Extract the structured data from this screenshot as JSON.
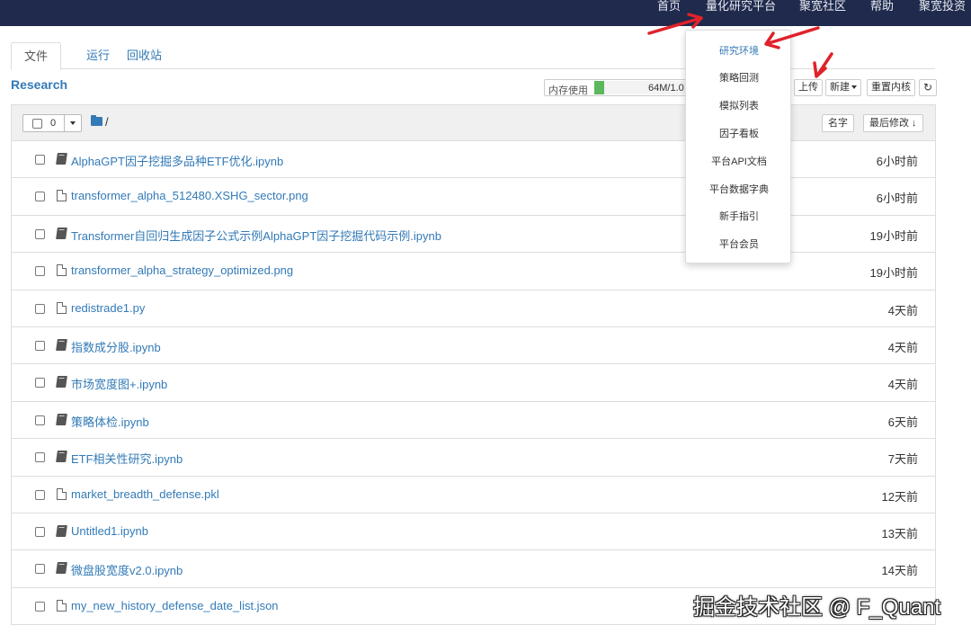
{
  "topnav": {
    "items": [
      "首页",
      "量化研究平台",
      "聚宽社区",
      "帮助",
      "聚宽投资"
    ]
  },
  "tabs": [
    "文件",
    "运行",
    "回收站"
  ],
  "research_title": "Research",
  "memory": {
    "label": "内存使用",
    "value": "64M/1.0",
    "fraction": 0.06
  },
  "toolbar": {
    "upload": "上传",
    "new": "新建",
    "restart": "重置内核",
    "reload_icon": "↻"
  },
  "listhead": {
    "selected_count": "0",
    "path": "/",
    "sort_name": "名字",
    "sort_modified": "最后修改 ↓"
  },
  "files": [
    {
      "name": "AlphaGPT因子挖掘多品种ETF优化.ipynb",
      "type": "notebook",
      "time": "6小时前"
    },
    {
      "name": "transformer_alpha_512480.XSHG_sector.png",
      "type": "file",
      "time": "6小时前"
    },
    {
      "name": "Transformer自回归生成因子公式示例AlphaGPT因子挖掘代码示例.ipynb",
      "type": "notebook",
      "time": "19小时前"
    },
    {
      "name": "transformer_alpha_strategy_optimized.png",
      "type": "file",
      "time": "19小时前"
    },
    {
      "name": "redistrade1.py",
      "type": "file",
      "time": "4天前"
    },
    {
      "name": "指数成分股.ipynb",
      "type": "notebook",
      "time": "4天前"
    },
    {
      "name": "市场宽度图+.ipynb",
      "type": "notebook",
      "time": "4天前"
    },
    {
      "name": "策略体检.ipynb",
      "type": "notebook",
      "time": "6天前"
    },
    {
      "name": "ETF相关性研究.ipynb",
      "type": "notebook",
      "time": "7天前"
    },
    {
      "name": "market_breadth_defense.pkl",
      "type": "file",
      "time": "12天前"
    },
    {
      "name": "Untitled1.ipynb",
      "type": "notebook",
      "time": "13天前"
    },
    {
      "name": "微盘股宽度v2.0.ipynb",
      "type": "notebook",
      "time": "14天前"
    },
    {
      "name": "my_new_history_defense_date_list.json",
      "type": "file",
      "time": ""
    }
  ],
  "dropdown_menu": {
    "items": [
      "研究环境",
      "策略回测",
      "模拟列表",
      "因子看板",
      "平台API文档",
      "平台数据字典",
      "新手指引",
      "平台会员"
    ],
    "active_index": 0
  },
  "annotation_color": "#e0222b",
  "watermark": "掘金技术社区 @ F_Quant"
}
